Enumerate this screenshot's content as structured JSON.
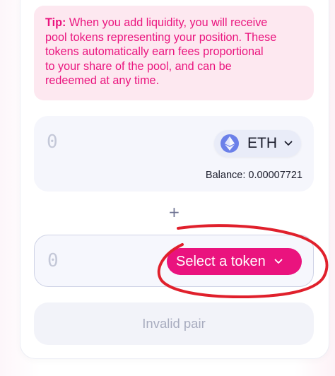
{
  "tip": {
    "label": "Tip:",
    "line1": " When you add liquidity, you will receive",
    "line2": "pool tokens representing your position. These",
    "line3": "tokens automatically earn fees proportional",
    "line4": "to your share of the pool, and can be",
    "line5": "redeemed at any time."
  },
  "input_a": {
    "amount_placeholder": "0",
    "token_symbol": "ETH",
    "token_icon": "ethereum-icon",
    "balance_text": "Balance: 0.00007721"
  },
  "separator": "+",
  "input_b": {
    "amount_placeholder": "0",
    "select_label": "Select a token"
  },
  "submit": {
    "label": "Invalid pair"
  },
  "colors": {
    "accent": "#ea137e",
    "tip_bg": "#fde8f0",
    "annotation": "#e0202c"
  }
}
